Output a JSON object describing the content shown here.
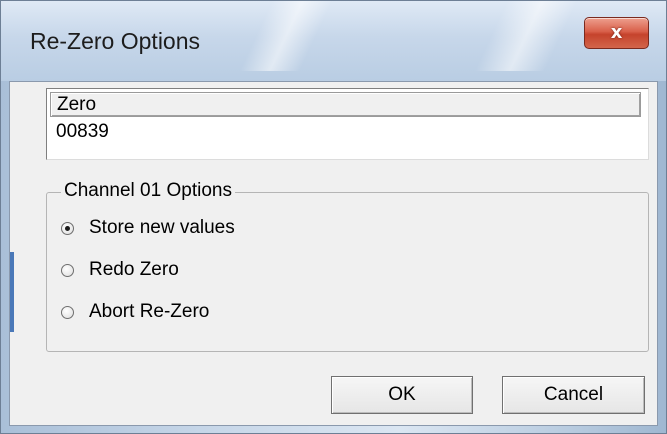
{
  "window": {
    "title": "Re-Zero Options",
    "close_glyph": "x"
  },
  "zero_list": {
    "header": "Zero",
    "value": "00839"
  },
  "channel_options": {
    "title": "Channel 01 Options",
    "options": [
      {
        "label": "Store new values",
        "selected": true
      },
      {
        "label": "Redo Zero",
        "selected": false
      },
      {
        "label": "Abort Re-Zero",
        "selected": false
      }
    ]
  },
  "buttons": {
    "ok_label": "OK",
    "cancel_label": "Cancel"
  },
  "colors": {
    "close_button": "#d9604a",
    "dialog_face": "#f0f0f0",
    "titlebar": "#c7d7ea"
  }
}
